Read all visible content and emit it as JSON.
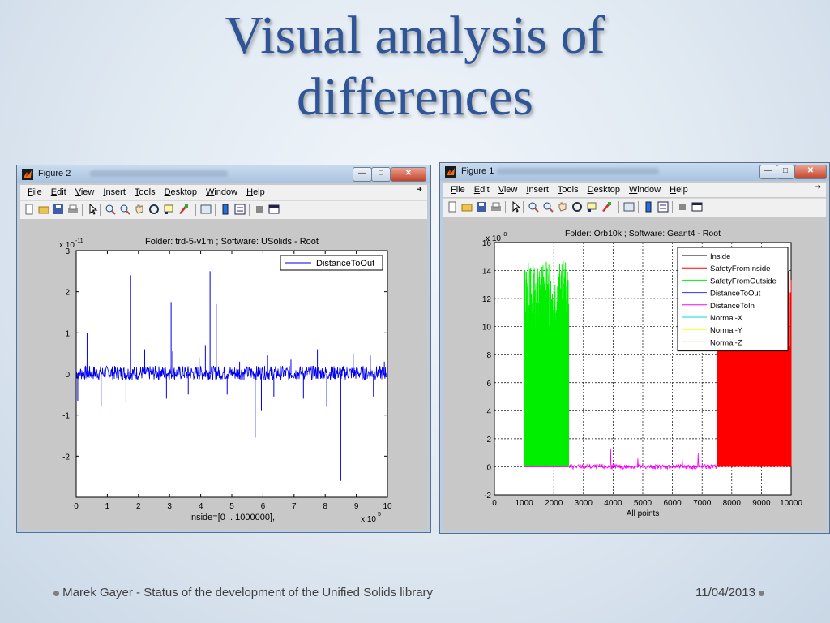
{
  "slide": {
    "title_line1": "Visual analysis of",
    "title_line2": "differences",
    "footer_left": "Marek Gayer - Status of the development of the Unified Solids library",
    "footer_right": "11/04/2013"
  },
  "menu_items": [
    "File",
    "Edit",
    "View",
    "Insert",
    "Tools",
    "Desktop",
    "Window",
    "Help"
  ],
  "toolbar_icons": [
    "new-file-icon",
    "open-folder-icon",
    "save-icon",
    "print-icon",
    "pointer-icon",
    "zoom-in-icon",
    "zoom-out-icon",
    "pan-icon",
    "rotate-icon",
    "data-cursor-icon",
    "brush-icon",
    "link-plot-icon",
    "colorbar-icon",
    "legend-icon",
    "hide-plot-tools-icon",
    "show-plot-tools-icon"
  ],
  "window_left": {
    "title": "Figure 2",
    "colors": {
      "line": "#0000ee",
      "axes_bg": "#ffffff",
      "fig_bg": "#c8c8c8"
    }
  },
  "window_right": {
    "title": "Figure 1"
  },
  "chart_data": [
    {
      "type": "line",
      "title": "Folder: trd-5-v1m ; Software: USolids - Root",
      "xlabel": "Inside=[0 .. 1000000],",
      "x_multiplier": "x 10",
      "x_multiplier_exp": "5",
      "y_multiplier": "x 10",
      "y_multiplier_exp": "-11",
      "xlim": [
        0,
        10
      ],
      "ylim": [
        -3,
        3
      ],
      "xticks": [
        "0",
        "1",
        "2",
        "3",
        "4",
        "5",
        "6",
        "7",
        "8",
        "9",
        "10"
      ],
      "yticks": [
        "-2",
        "-1",
        "0",
        "1",
        "2",
        "3"
      ],
      "ytick_values": [
        -2,
        -1,
        0,
        1,
        2,
        3
      ],
      "grid": false,
      "legend_position": "top-right",
      "series": [
        {
          "name": "DistanceToOut",
          "color": "#0000ee",
          "noise_band": [
            -0.15,
            0.2
          ],
          "spikes": [
            {
              "x": 0.05,
              "y": -0.65
            },
            {
              "x": 0.35,
              "y": 1.0
            },
            {
              "x": 0.8,
              "y": -0.8
            },
            {
              "x": 1.6,
              "y": -0.7
            },
            {
              "x": 1.75,
              "y": 2.4
            },
            {
              "x": 2.2,
              "y": 0.6
            },
            {
              "x": 2.9,
              "y": -0.6
            },
            {
              "x": 3.05,
              "y": 1.75
            },
            {
              "x": 3.1,
              "y": 0.55
            },
            {
              "x": 3.6,
              "y": -0.5
            },
            {
              "x": 3.95,
              "y": 0.4
            },
            {
              "x": 4.15,
              "y": 0.7
            },
            {
              "x": 4.3,
              "y": 2.5
            },
            {
              "x": 4.5,
              "y": 1.7
            },
            {
              "x": 4.85,
              "y": -0.5
            },
            {
              "x": 5.25,
              "y": 0.3
            },
            {
              "x": 5.75,
              "y": -1.55
            },
            {
              "x": 5.95,
              "y": -0.9
            },
            {
              "x": 6.15,
              "y": 0.45
            },
            {
              "x": 6.35,
              "y": -0.55
            },
            {
              "x": 6.9,
              "y": 0.35
            },
            {
              "x": 7.3,
              "y": -0.6
            },
            {
              "x": 7.75,
              "y": 0.6
            },
            {
              "x": 8.05,
              "y": -0.8
            },
            {
              "x": 8.5,
              "y": -2.6
            },
            {
              "x": 8.9,
              "y": 0.5
            },
            {
              "x": 9.45,
              "y": 0.45
            },
            {
              "x": 9.55,
              "y": -0.55
            },
            {
              "x": 9.9,
              "y": 0.3
            }
          ]
        }
      ]
    },
    {
      "type": "line",
      "title": "Folder: Orb10k ; Software: Geant4 - Root",
      "xlabel": "All points",
      "y_multiplier": "x 10",
      "y_multiplier_exp": "-8",
      "xlim": [
        0,
        10000
      ],
      "ylim": [
        -2,
        16
      ],
      "xticks": [
        "0",
        "1000",
        "2000",
        "3000",
        "4000",
        "5000",
        "6000",
        "7000",
        "8000",
        "9000",
        "10000"
      ],
      "yticks": [
        "-2",
        "0",
        "2",
        "4",
        "6",
        "8",
        "10",
        "12",
        "14",
        "16"
      ],
      "ytick_values": [
        -2,
        0,
        2,
        4,
        6,
        8,
        10,
        12,
        14,
        16
      ],
      "grid": true,
      "legend_position": "top-right",
      "series": [
        {
          "name": "Inside",
          "color": "#000000"
        },
        {
          "name": "SafetyFromInside",
          "color": "#ff0000",
          "x_range": [
            7500,
            10000
          ],
          "y_band": [
            0,
            14
          ]
        },
        {
          "name": "SafetyFromOutside",
          "color": "#00ee00",
          "x_range": [
            1000,
            2500
          ],
          "y_band": [
            0,
            14.7
          ]
        },
        {
          "name": "DistanceToOut",
          "color": "#3030ff"
        },
        {
          "name": "DistanceToIn",
          "color": "#ff00ff",
          "baseline": 0
        },
        {
          "name": "Normal-X",
          "color": "#00dddd"
        },
        {
          "name": "Normal-Y",
          "color": "#ffff00"
        },
        {
          "name": "Normal-Z",
          "color": "#ff9900"
        }
      ]
    }
  ]
}
